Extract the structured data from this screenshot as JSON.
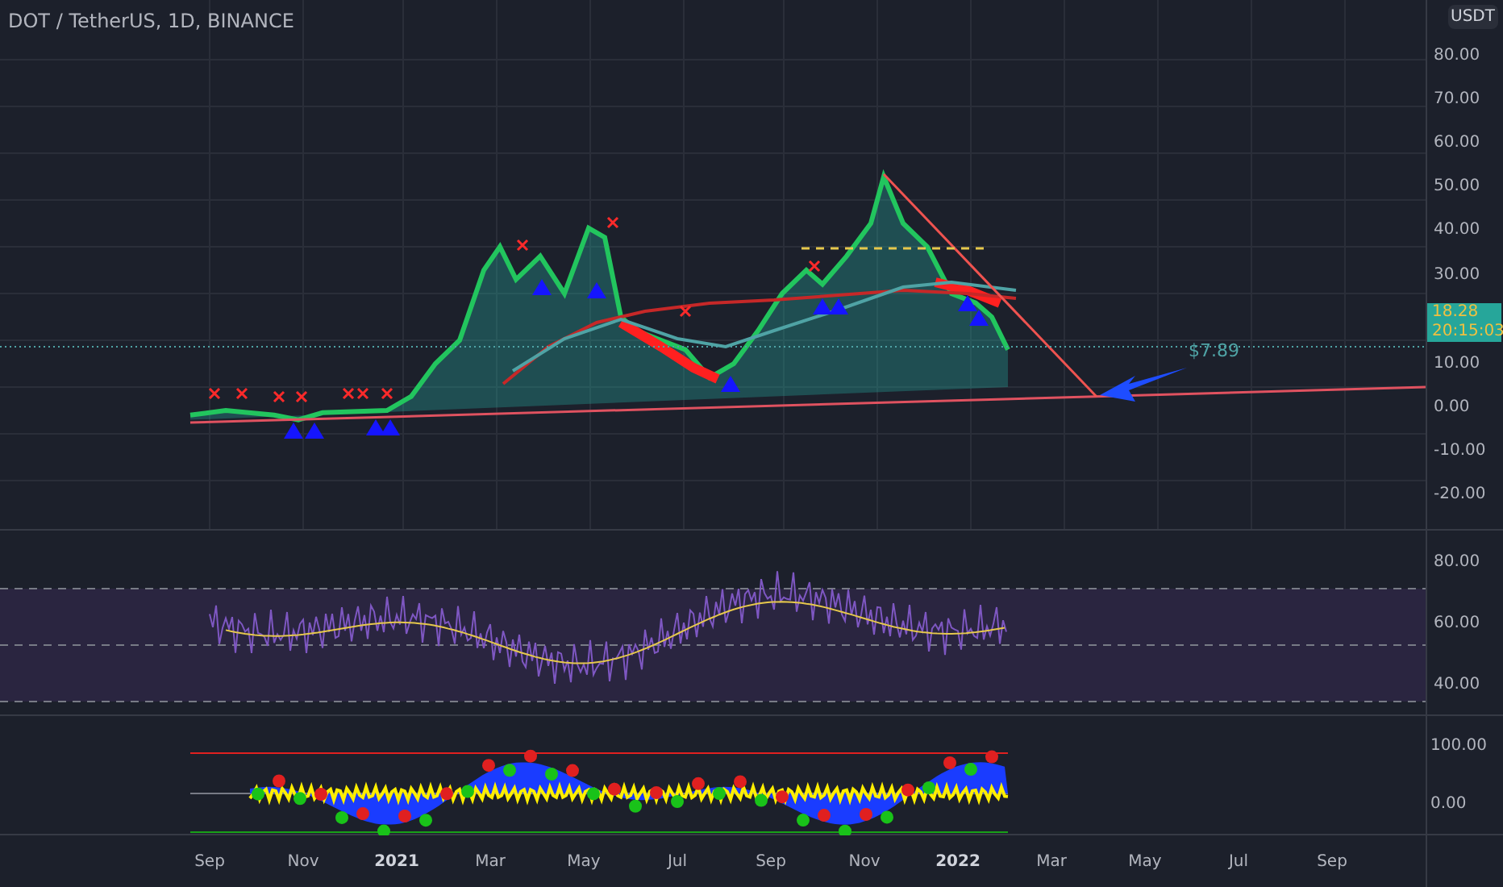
{
  "header": {
    "symbol": "DOT / TetherUS, 1D, BINANCE"
  },
  "price_axis": {
    "currency": "USDT",
    "upper_ticks": [
      "80.00",
      "70.00",
      "60.00",
      "50.00",
      "40.00",
      "30.00"
    ],
    "lower_ticks": [
      "10.00",
      "0.00",
      "-10.00",
      "-20.00"
    ],
    "last_price": "18.28",
    "countdown": "20:15:03"
  },
  "annotation": {
    "target": "$7.89"
  },
  "rsi_axis": {
    "ticks": [
      "80.00",
      "60.00",
      "40.00"
    ]
  },
  "oscillator_axis": {
    "ticks": [
      "100.00",
      "0.00"
    ]
  },
  "time_axis": {
    "labels": [
      {
        "text": "Sep",
        "kind": "month"
      },
      {
        "text": "Nov",
        "kind": "month"
      },
      {
        "text": "2021",
        "kind": "year"
      },
      {
        "text": "Mar",
        "kind": "month"
      },
      {
        "text": "May",
        "kind": "month"
      },
      {
        "text": "Jul",
        "kind": "month"
      },
      {
        "text": "Sep",
        "kind": "month"
      },
      {
        "text": "Nov",
        "kind": "month"
      },
      {
        "text": "2022",
        "kind": "year"
      },
      {
        "text": "Mar",
        "kind": "month"
      },
      {
        "text": "May",
        "kind": "month"
      },
      {
        "text": "Jul",
        "kind": "month"
      },
      {
        "text": "Sep",
        "kind": "month"
      }
    ]
  }
}
